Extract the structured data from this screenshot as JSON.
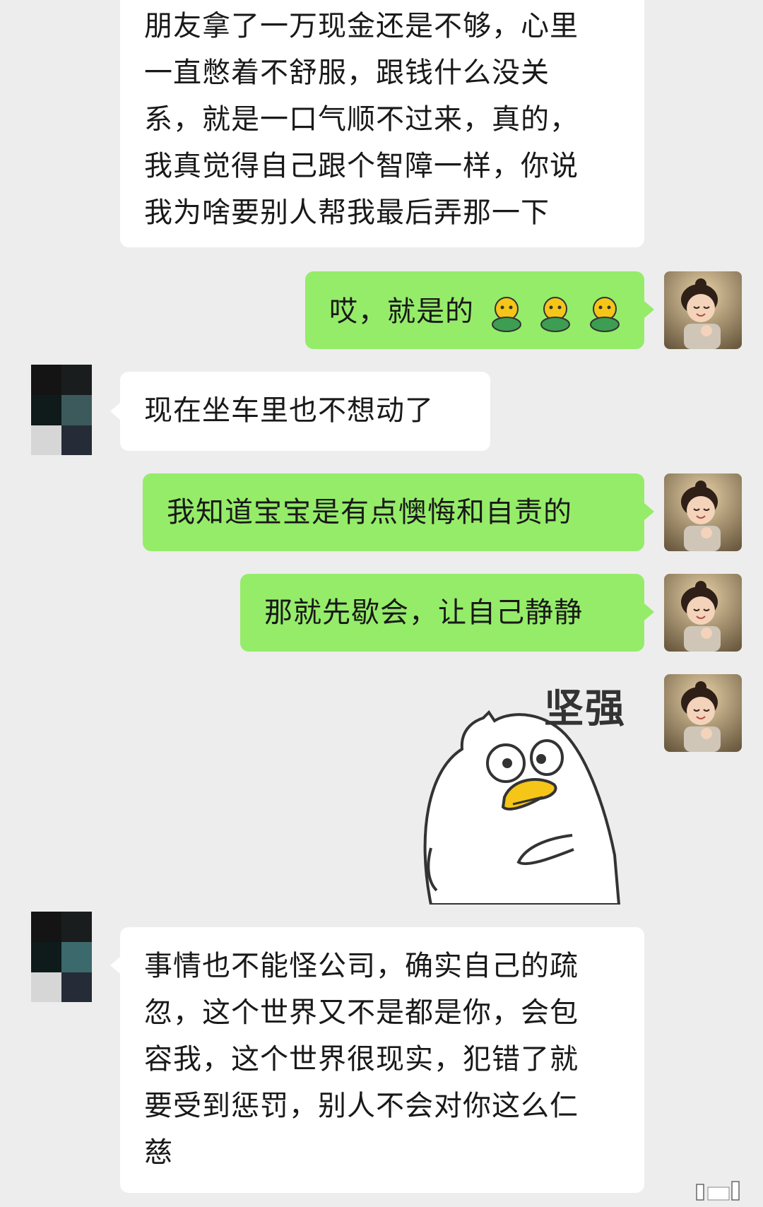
{
  "messages": [
    {
      "side": "in",
      "text": "朋友拿了一万现金还是不够，心里\n一直憋着不舒服，跟钱什么没关\n系，就是一口气顺不过来，真的，\n我真觉得自己跟个智障一样，你说\n我为啥要别人帮我最后弄那一下"
    },
    {
      "side": "out",
      "text": "哎，就是的",
      "emoji": [
        "duck-emoji",
        "duck-emoji",
        "duck-emoji"
      ]
    },
    {
      "side": "in",
      "text": "现在坐车里也不想动了"
    },
    {
      "side": "out",
      "text": "我知道宝宝是有点懊悔和自责的"
    },
    {
      "side": "out",
      "text": "那就先歇会，让自己静静"
    },
    {
      "side": "out",
      "sticker": "duck-sticker",
      "sticker_caption": "坚强"
    },
    {
      "side": "in",
      "text": "事情也不能怪公司，确实自己的疏\n忽，这个世界又不是都是你，会包\n容我，这个世界很现实，犯错了就\n要受到惩罚，别人不会对你这么仁\n慈"
    }
  ],
  "colors": {
    "background": "#ededed",
    "bubble_in": "#ffffff",
    "bubble_out": "#95ec69",
    "text": "#191919"
  },
  "icons": {
    "contact_avatar": "mosaic-avatar",
    "self_avatar": "girl-photo-avatar"
  }
}
